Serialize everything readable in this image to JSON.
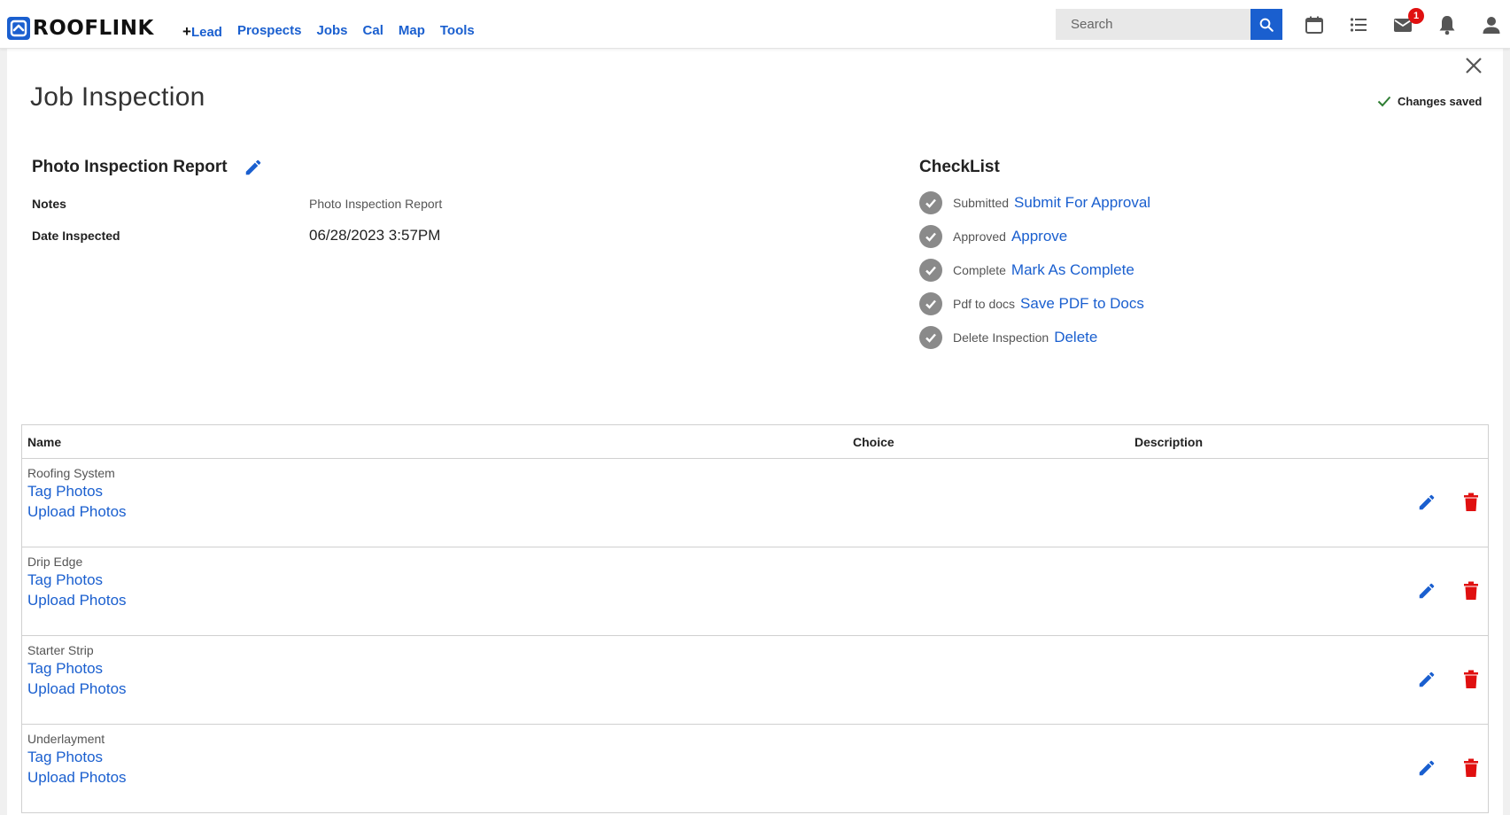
{
  "brand": {
    "name": "ROOFLINK",
    "color": "#1a5fcf"
  },
  "nav": {
    "lead_label": "Lead",
    "items": [
      {
        "label": "Prospects"
      },
      {
        "label": "Jobs"
      },
      {
        "label": "Cal"
      },
      {
        "label": "Map"
      },
      {
        "label": "Tools"
      }
    ]
  },
  "search": {
    "placeholder": "Search",
    "value": ""
  },
  "header_icons": {
    "calendar": "calendar-icon",
    "list": "list-icon",
    "mail": "mail-icon",
    "mail_badge": "1",
    "bell": "bell-icon",
    "user": "user-icon"
  },
  "page": {
    "title": "Job Inspection",
    "status": "Changes saved"
  },
  "report": {
    "title": "Photo Inspection Report",
    "notes_label": "Notes",
    "notes_value": "Photo Inspection Report",
    "date_label": "Date Inspected",
    "date_value": "06/28/2023 3:57PM"
  },
  "checklist": {
    "title": "CheckList",
    "items": [
      {
        "label": "Submitted",
        "action": "Submit For Approval"
      },
      {
        "label": "Approved",
        "action": "Approve"
      },
      {
        "label": "Complete",
        "action": "Mark As Complete"
      },
      {
        "label": "Pdf to docs",
        "action": "Save PDF to Docs"
      },
      {
        "label": "Delete Inspection",
        "action": "Delete"
      }
    ]
  },
  "table": {
    "columns": {
      "name": "Name",
      "choice": "Choice",
      "description": "Description"
    },
    "rows": [
      {
        "name": "Roofing System",
        "tag": "Tag Photos",
        "upload": "Upload Photos"
      },
      {
        "name": "Drip Edge",
        "tag": "Tag Photos",
        "upload": "Upload Photos"
      },
      {
        "name": "Starter Strip",
        "tag": "Tag Photos",
        "upload": "Upload Photos"
      },
      {
        "name": "Underlayment",
        "tag": "Tag Photos",
        "upload": "Upload Photos"
      }
    ]
  },
  "colors": {
    "link": "#1a5fcf",
    "delete": "#e01010",
    "check": "#8a8a8a"
  }
}
